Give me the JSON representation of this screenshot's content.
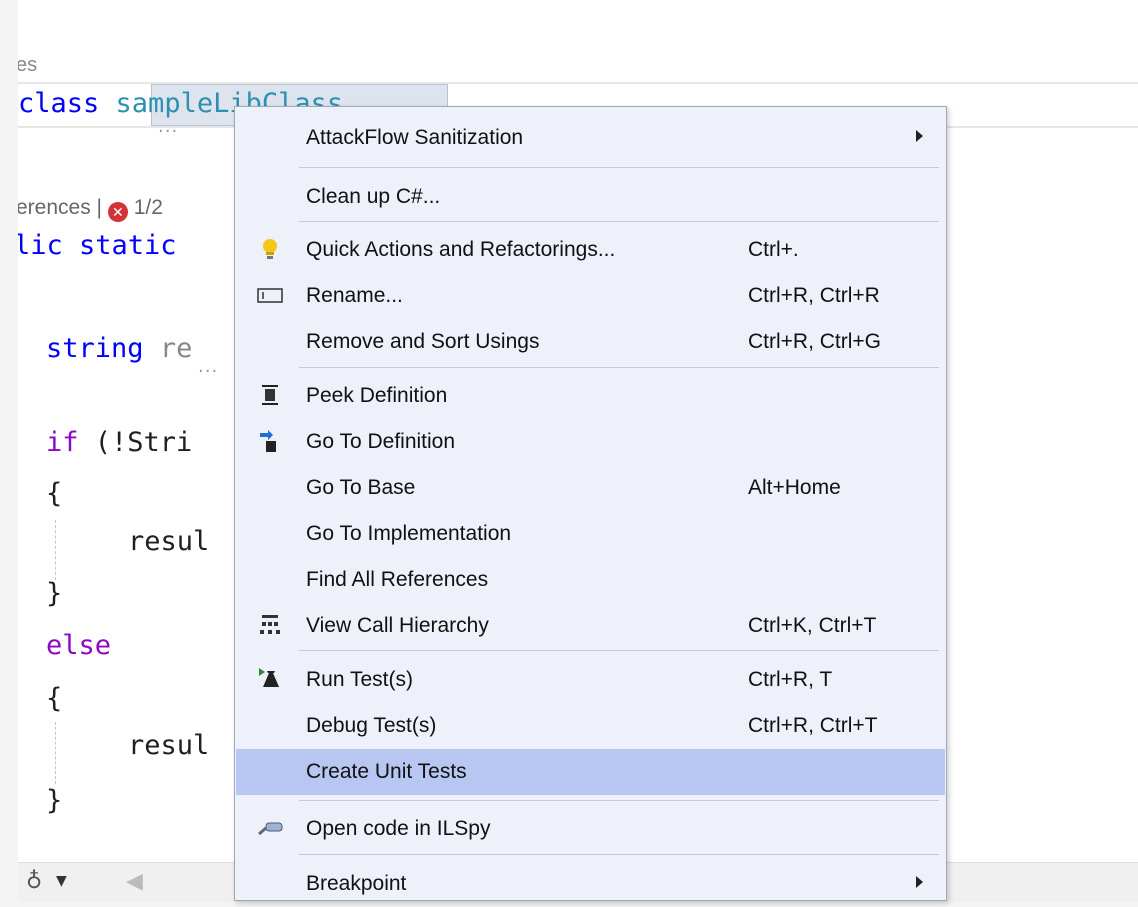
{
  "editor": {
    "partial_top_text": "es",
    "line_class": {
      "keyword": "class",
      "name": "sampleLibClass"
    },
    "codelens": {
      "references": "erences | ",
      "errors": "1/2"
    },
    "line_method": "lic static",
    "line_string": {
      "type": "string",
      "ident": "re"
    },
    "line_if": {
      "keyword": "if",
      "rest": " (!Stri"
    },
    "brace_open_1": "{",
    "result_1": "resul",
    "brace_close_1": "}",
    "line_else": "else",
    "brace_open_2": "{",
    "result_2": "resul",
    "brace_close_2": "}"
  },
  "bottom_bar": {
    "icon": "bug-icon"
  },
  "context_menu": {
    "items": [
      {
        "label": "AttackFlow Sanitization",
        "shortcut": "",
        "submenu": true,
        "icon": ""
      },
      {
        "label": "Clean up C#...",
        "shortcut": "",
        "submenu": false,
        "icon": ""
      },
      {
        "label": "Quick Actions and Refactorings...",
        "shortcut": "Ctrl+.",
        "submenu": false,
        "icon": "lightbulb-icon"
      },
      {
        "label": "Rename...",
        "shortcut": "Ctrl+R, Ctrl+R",
        "submenu": false,
        "icon": "rename-icon"
      },
      {
        "label": "Remove and Sort Usings",
        "shortcut": "Ctrl+R, Ctrl+G",
        "submenu": false,
        "icon": ""
      },
      {
        "label": "Peek Definition",
        "shortcut": "",
        "submenu": false,
        "icon": "peek-definition-icon"
      },
      {
        "label": "Go To Definition",
        "shortcut": "",
        "submenu": false,
        "icon": "go-to-definition-icon"
      },
      {
        "label": "Go To Base",
        "shortcut": "Alt+Home",
        "submenu": false,
        "icon": ""
      },
      {
        "label": "Go To Implementation",
        "shortcut": "",
        "submenu": false,
        "icon": ""
      },
      {
        "label": "Find All References",
        "shortcut": "",
        "submenu": false,
        "icon": ""
      },
      {
        "label": "View Call Hierarchy",
        "shortcut": "Ctrl+K, Ctrl+T",
        "submenu": false,
        "icon": "call-hierarchy-icon"
      },
      {
        "label": "Run Test(s)",
        "shortcut": "Ctrl+R, T",
        "submenu": false,
        "icon": "run-test-icon"
      },
      {
        "label": "Debug Test(s)",
        "shortcut": "Ctrl+R, Ctrl+T",
        "submenu": false,
        "icon": ""
      },
      {
        "label": "Create Unit Tests",
        "shortcut": "",
        "submenu": false,
        "icon": "",
        "highlighted": true
      },
      {
        "label": "Open code in ILSpy",
        "shortcut": "",
        "submenu": false,
        "icon": "ilspy-icon"
      },
      {
        "label": "Breakpoint",
        "shortcut": "",
        "submenu": true,
        "icon": ""
      }
    ]
  },
  "colors": {
    "menu_background": "#eef0fa",
    "menu_highlight": "#b8c6f2",
    "keyword": "#0000ff",
    "control_keyword": "#8f08c4",
    "type": "#2b91af",
    "error": "#d13438"
  }
}
